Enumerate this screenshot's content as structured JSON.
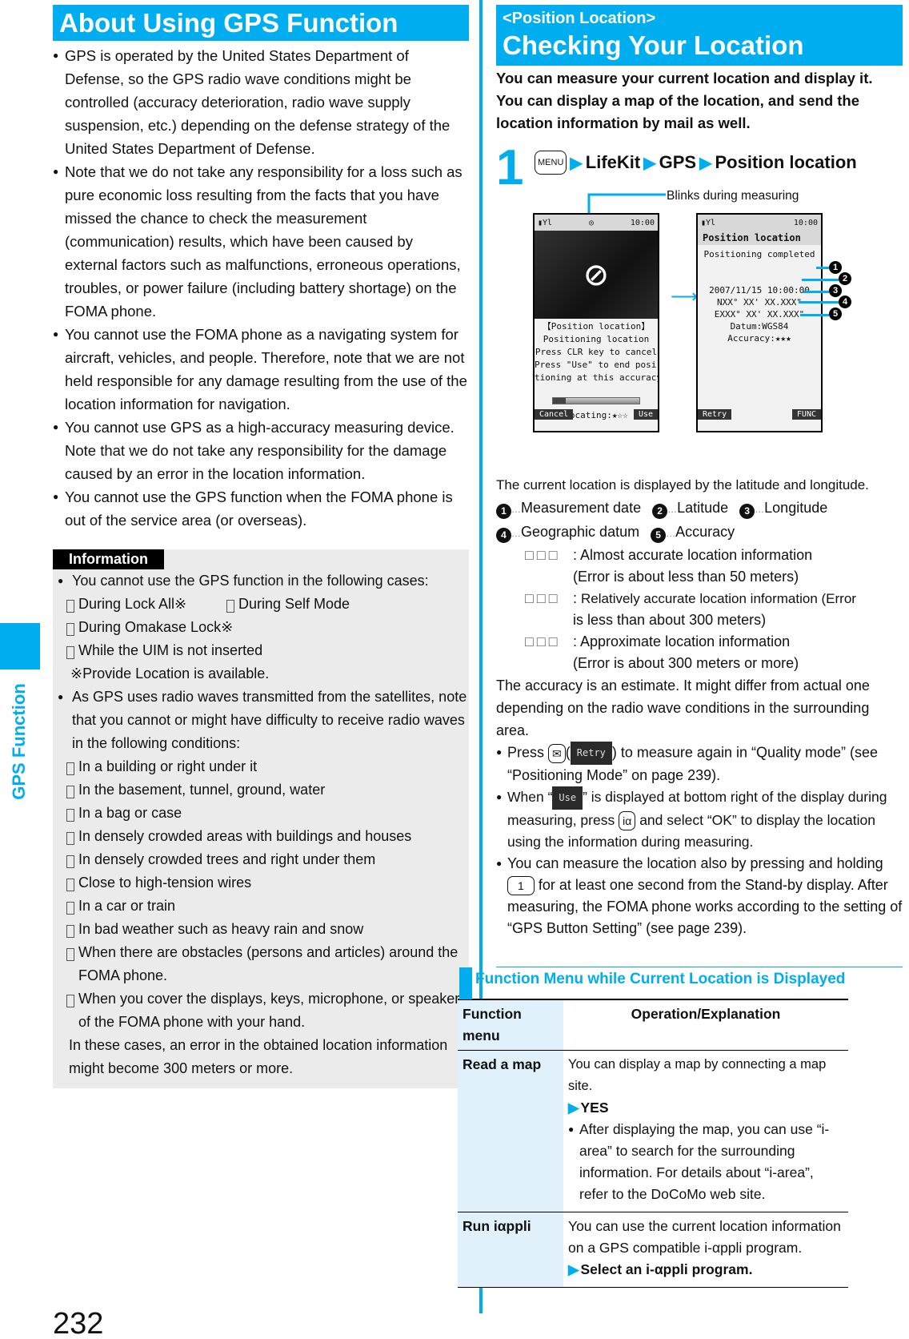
{
  "side_tab": {
    "label": "GPS Function"
  },
  "page_number": "232",
  "colors": {
    "accent": "#00aeef",
    "info_bg": "#ebebeb",
    "table_shade": "#e1f1fc"
  },
  "left": {
    "title": "About Using GPS Function",
    "bullets": [
      "GPS is operated by the United States Department of Defense, so the GPS radio wave conditions might be controlled (accuracy deterioration, radio wave supply suspension, etc.) depending on the defense strategy of the United States Department of Defense.",
      "Note that we do not take any responsibility for a loss such as pure economic loss resulting from the facts that you have missed the chance to check the measurement (communication) results, which have been caused by external factors such as malfunctions, erroneous operations, troubles, or power failure (including battery shortage) on the FOMA phone.",
      "You cannot use the FOMA phone as a navigating system for aircraft, vehicles, and people. Therefore, note that we are not held responsible for any damage resulting from the use of the location information for navigation.",
      "You cannot use GPS as a high-accuracy measuring device. Note that we do not take any responsibility for the damage caused by an error in the location information.",
      "You cannot use the GPS function when the FOMA phone is out of the service area (or overseas)."
    ],
    "info": {
      "tag": "Information",
      "bullet1": "You cannot use the GPS function in the following cases:",
      "cases": [
        "During Lock All※",
        "During Self Mode",
        "During Omakase Lock※",
        "While the UIM is not inserted"
      ],
      "footnote": "※Provide Location is available.",
      "bullet2": "As GPS uses radio waves transmitted from the satellites, note that you cannot or might have difficulty to receive radio waves in the following conditions:",
      "conditions": [
        "In a building or right under it",
        "In the basement, tunnel, ground, water",
        "In a bag or case",
        "In densely crowded areas with buildings and houses",
        "In densely crowded trees and right under them",
        "Close to high-tension wires",
        "In a car or train",
        "In bad weather such as heavy rain and snow",
        "When there are obstacles (persons and articles) around the FOMA phone.",
        "When you cover the displays, keys, microphone, or speakers of the FOMA phone with your hand."
      ],
      "closing": "In these cases, an error in the obtained location information might become 300 meters or more."
    }
  },
  "right": {
    "subtitle": "<Position Location>",
    "title": "Checking Your Location",
    "intro": "You can measure your current location and display it. You can display a map of the location, and send the location information by mail as well.",
    "step": {
      "number": "1",
      "key": "MENU",
      "path": [
        "LifeKit",
        "GPS",
        "Position location"
      ]
    },
    "callout": "Blinks during measuring",
    "screen1": {
      "time": "10:00",
      "lines": [
        "【Position location】",
        "Positioning location",
        "Press CLR key to cancel",
        "Press \"Use\" to end posi-",
        "tioning at this accuracy"
      ],
      "progress": 0.15,
      "locating": "Locating:★☆☆",
      "soft_left": "Cancel",
      "soft_right": "Use"
    },
    "screen2": {
      "time": "10:00",
      "title": "Position location",
      "status": "Positioning completed",
      "date": "2007/11/15 10:00:00",
      "lat": "NXX° XX' XX.XXX\"",
      "lon": "EXXX° XX' XX.XXX\"",
      "datum": "Datum:WGS84",
      "accuracy": "Accuracy:★★★",
      "soft_left": "Retry",
      "soft_right": "FUNC"
    },
    "caption": "The current location is displayed by the latitude and longitude.",
    "legend": [
      {
        "n": "1",
        "label": "Measurement date"
      },
      {
        "n": "2",
        "label": "Latitude"
      },
      {
        "n": "3",
        "label": "Longitude"
      },
      {
        "n": "4",
        "label": "Geographic datum"
      },
      {
        "n": "5",
        "label": "Accuracy"
      }
    ],
    "accuracy_levels": [
      {
        "symbol": "□□□",
        "desc": "Almost accurate location information",
        "detail": "(Error is about less than 50 meters)"
      },
      {
        "symbol": "□□□",
        "desc": "Relatively accurate location information (Error",
        "detail": "is less than about 300 meters)"
      },
      {
        "symbol": "□□□",
        "desc": "Approximate location information",
        "detail": "(Error is about 300 meters or more)"
      }
    ],
    "accuracy_note": "The accuracy is an estimate. It might differ from actual one depending on the radio wave conditions in the surrounding area.",
    "notes": {
      "retry_pre": "Press",
      "retry_chip": "Retry",
      "retry_post": ") to measure again in “Quality mode” (see “Positioning Mode” on page 239).",
      "use_pre": "When “",
      "use_chip": "Use",
      "use_mid": "” is displayed at bottom right of the display during measuring, press",
      "use_key": "iα",
      "use_post": "and select “OK” to display the location using the information during measuring.",
      "hold_pre": "You can measure the location also by pressing and holding",
      "hold_key": "1",
      "hold_post": "for at least one second from the Stand-by display. After measuring, the FOMA phone works according to the setting of “GPS Button Setting” (see page 239)."
    },
    "function_menu": {
      "heading": "Function Menu while Current Location is Displayed",
      "columns": [
        "Function menu",
        "Operation/Explanation"
      ],
      "rows": [
        {
          "name": "Read a map",
          "text": "You can display a map by connecting a map site.",
          "action": "YES",
          "bullet": "After displaying the map, you can use “i-area” to search for the surrounding information. For details about “i-area”, refer to the DoCoMo web site."
        },
        {
          "name": "Run iαppli",
          "text": "You can use the current location information on a GPS compatible i-αppli program.",
          "action": "Select an i-αppli program."
        }
      ]
    }
  }
}
